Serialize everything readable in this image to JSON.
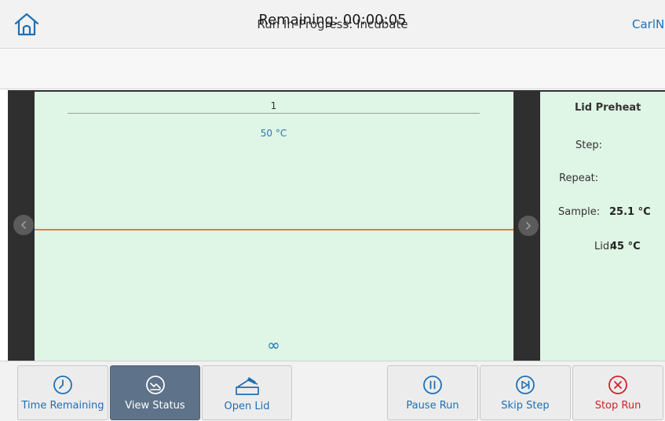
{
  "header": {
    "title": "Run In-Progress: Incubate",
    "user": "CarlN",
    "home_icon": "home-icon"
  },
  "remaining": {
    "text": "Remaining: 00:00:05"
  },
  "graph": {
    "step_number": "1",
    "temperature": "50 °C",
    "hold_symbol": "∞",
    "line_color": "#e87e2a",
    "background": "#dff5e5"
  },
  "status_panel": {
    "title": "Lid Preheat",
    "step_label": "Step:",
    "repeat_label": "Repeat:",
    "sample_label": "Sample:",
    "sample_value": "25.1 °C",
    "lid_label": "Lid:",
    "lid_value": "45 °C"
  },
  "toolbar": {
    "time_remaining": "Time Remaining",
    "view_status": "View Status",
    "open_lid": "Open Lid",
    "pause_run": "Pause Run",
    "skip_step": "Skip Step",
    "stop_run": "Stop Run",
    "active_color": "#5e7289",
    "accent_color": "#1f6fb5",
    "stop_color": "#d4202a"
  },
  "icons": {
    "time": "clock-icon",
    "status": "chart-icon",
    "lid": "open-lid-icon",
    "pause": "pause-icon",
    "skip": "skip-icon",
    "stop": "stop-icon",
    "prev": "chevron-left-icon",
    "next": "chevron-right-icon"
  }
}
